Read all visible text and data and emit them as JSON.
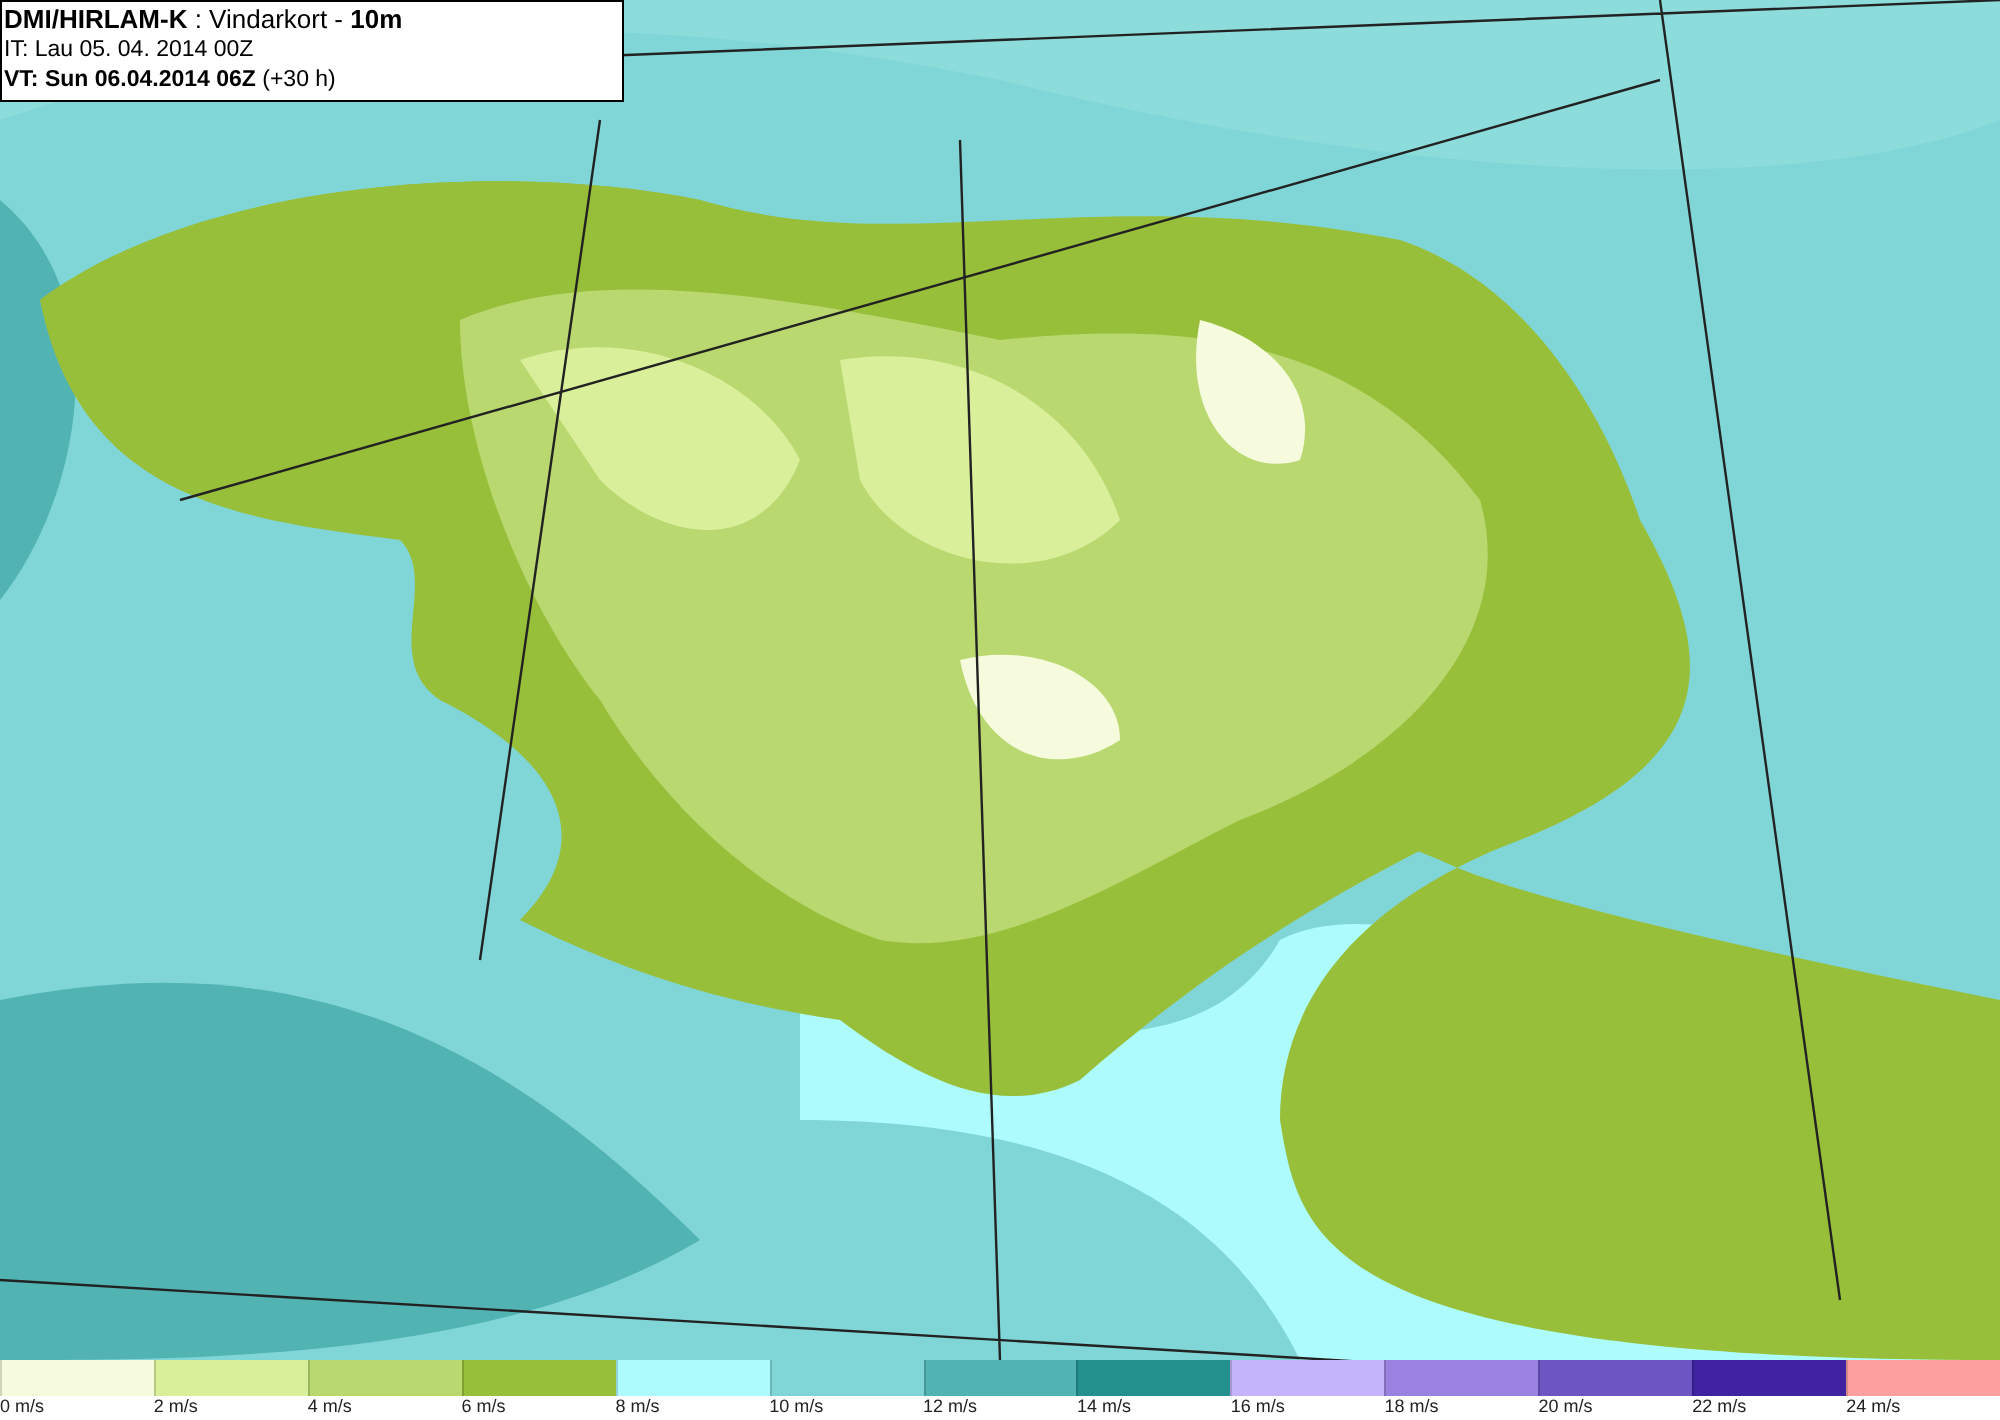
{
  "header": {
    "lines": [
      "**DMI/HIRLAM-K** : Vindarkort - **10m**",
      "IT: Lau 05. 04. 2014 00Z",
      "**VT: Sun 06.04.2014 06Z** (+30 h)"
    ]
  },
  "legend": [
    {
      "label": "0 m/s",
      "color": "#f5fbdc"
    },
    {
      "label": "2 m/s",
      "color": "#d9ef9a"
    },
    {
      "label": "4 m/s",
      "color": "#b9d870"
    },
    {
      "label": "6 m/s",
      "color": "#98bf3a"
    },
    {
      "label": "8 m/s",
      "color": "#adfbfd"
    },
    {
      "label": "10 m/s",
      "color": "#80d6d6"
    },
    {
      "label": "12 m/s",
      "color": "#52b3b3"
    },
    {
      "label": "14 m/s",
      "color": "#23908e"
    },
    {
      "label": "16 m/s",
      "color": "#c4b4fb"
    },
    {
      "label": "18 m/s",
      "color": "#9a82e0"
    },
    {
      "label": "20 m/s",
      "color": "#6d55c4"
    },
    {
      "label": "22 m/s",
      "color": "#3f23a1"
    },
    {
      "label": "24 m/s",
      "color": "#fb9f9f"
    }
  ]
}
